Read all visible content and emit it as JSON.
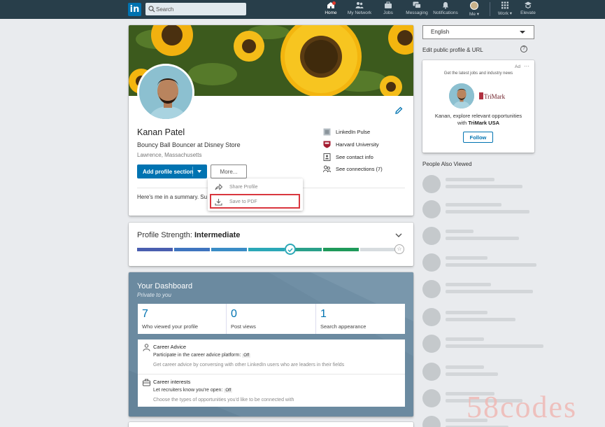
{
  "nav": {
    "logo": "in",
    "search_placeholder": "Search",
    "items": [
      {
        "label": "Home",
        "icon": "home-icon"
      },
      {
        "label": "My Network",
        "icon": "network-icon"
      },
      {
        "label": "Jobs",
        "icon": "briefcase-icon"
      },
      {
        "label": "Messaging",
        "icon": "messaging-icon"
      },
      {
        "label": "Notifications",
        "icon": "bell-icon"
      },
      {
        "label": "Me",
        "icon": "avatar-icon"
      },
      {
        "label": "Work",
        "icon": "grid-icon"
      },
      {
        "label": "Elevate",
        "icon": "elevate-icon"
      }
    ]
  },
  "profile": {
    "name": "Kanan Patel",
    "headline": "Bouncy Ball Bouncer at Disney Store",
    "location": "Lawrence, Massachusetts",
    "add_section_label": "Add profile section",
    "more_label": "More...",
    "summary": "Here's me in a summary. Su",
    "side_links": [
      {
        "label": "LinkedIn Pulse",
        "icon": "pulse-icon"
      },
      {
        "label": "Harvard University",
        "icon": "harvard-shield-icon"
      },
      {
        "label": "See contact info",
        "icon": "contact-card-icon"
      },
      {
        "label": "See connections (7)",
        "icon": "connections-icon"
      }
    ]
  },
  "more_menu": {
    "items": [
      {
        "label": "Share Profile",
        "icon": "share-arrow-icon"
      },
      {
        "label": "Save to PDF",
        "icon": "download-icon"
      }
    ]
  },
  "strength": {
    "prefix": "Profile Strength: ",
    "level": "Intermediate",
    "progress": 0.6
  },
  "dashboard": {
    "title": "Your Dashboard",
    "subtitle": "Private to you",
    "stats": [
      {
        "value": "7",
        "label": "Who viewed your profile"
      },
      {
        "value": "0",
        "label": "Post views"
      },
      {
        "value": "1",
        "label": "Search appearance"
      }
    ],
    "career_advice": {
      "title": "Career Advice",
      "line": "Participate in the career advice platform:",
      "status": "Off",
      "desc": "Get career advice by conversing with other LinkedIn users who are leaders in their fields"
    },
    "career_interests": {
      "title": "Career interests",
      "line": "Let recruiters know you're open:",
      "status": "Off",
      "desc": "Choose the types of opportunities you'd like to be connected with"
    }
  },
  "rail": {
    "language": "English",
    "edit_url": "Edit public profile & URL",
    "ad": {
      "tag": "Ad",
      "line1": "Get the latest jobs and industry news",
      "brand": "TriMark",
      "line2": "Kanan, explore relevant opportunities",
      "line3_prefix": "with ",
      "line3_brand": "TriMark USA",
      "follow": "Follow"
    },
    "people_also_viewed": "People Also Viewed"
  },
  "watermark": "58codes",
  "colors": {
    "nav_bg": "#283e4a",
    "brand_blue": "#0073b1",
    "dashboard_bg": "#6b8aa0",
    "highlight_red": "#d9363e"
  }
}
